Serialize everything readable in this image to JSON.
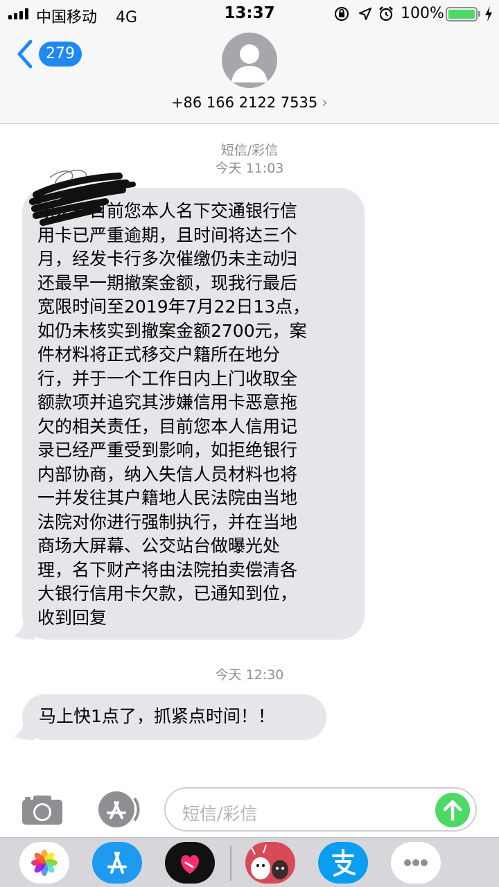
{
  "status_bar": {
    "carrier": "中国移动",
    "network": "4G",
    "time": "13:37",
    "battery_percent": "100%",
    "battery_level": 1.0,
    "icons": [
      "orientation-lock-icon",
      "location-icon",
      "alarm-icon",
      "charging-icon"
    ]
  },
  "nav": {
    "back_count": "279",
    "contact_number": "+86 166 2122 7535",
    "contact_chevron": "›"
  },
  "conversation": {
    "label": "短信/彩信",
    "timestamp1": "今天 11:03",
    "message1_lines": [
      "谢×× 目前您本人名下交通银行信",
      "用卡已严重逾期，且时间将达三个",
      "月，经发卡行多次催缴仍未主动归",
      "还最早一期撤案金额，现我行最后",
      "宽限时间至2019年7月22日13点，",
      "如仍未核实到撤案金额2700元，案",
      "件材料将正式移交户籍所在地分",
      "行，并于一个工作日内上门收取全",
      "额款项并追究其涉嫌信用卡恶意拖",
      "欠的相关责任，目前您本人信用记",
      "录已经严重受到影响，如拒绝银行",
      "内部协商，纳入失信人员材料也将",
      "一并发往其户籍地人民法院由当地",
      "法院对你进行强制执行，并在当地",
      "商场大屏幕、公交站台做曝光处",
      "理，名下财产将由法院拍卖偿清各",
      "大银行信用卡欠款，已通知到位，",
      "收到回复"
    ],
    "timestamp2": "今天 12:30",
    "message2": "马上快1点了，抓紧点时间！！"
  },
  "input": {
    "placeholder": "短信/彩信"
  },
  "drawer": {
    "apps": [
      "photos-app-icon",
      "app-store-app-icon",
      "digital-touch-app-icon",
      "sticker-app-icon",
      "alipay-app-icon",
      "more-apps-icon"
    ]
  },
  "colors": {
    "accent_blue": "#1e88f5",
    "send_green": "#4cd964",
    "bubble_gray": "#e5e5ea",
    "meta_gray": "#8e8e93"
  }
}
